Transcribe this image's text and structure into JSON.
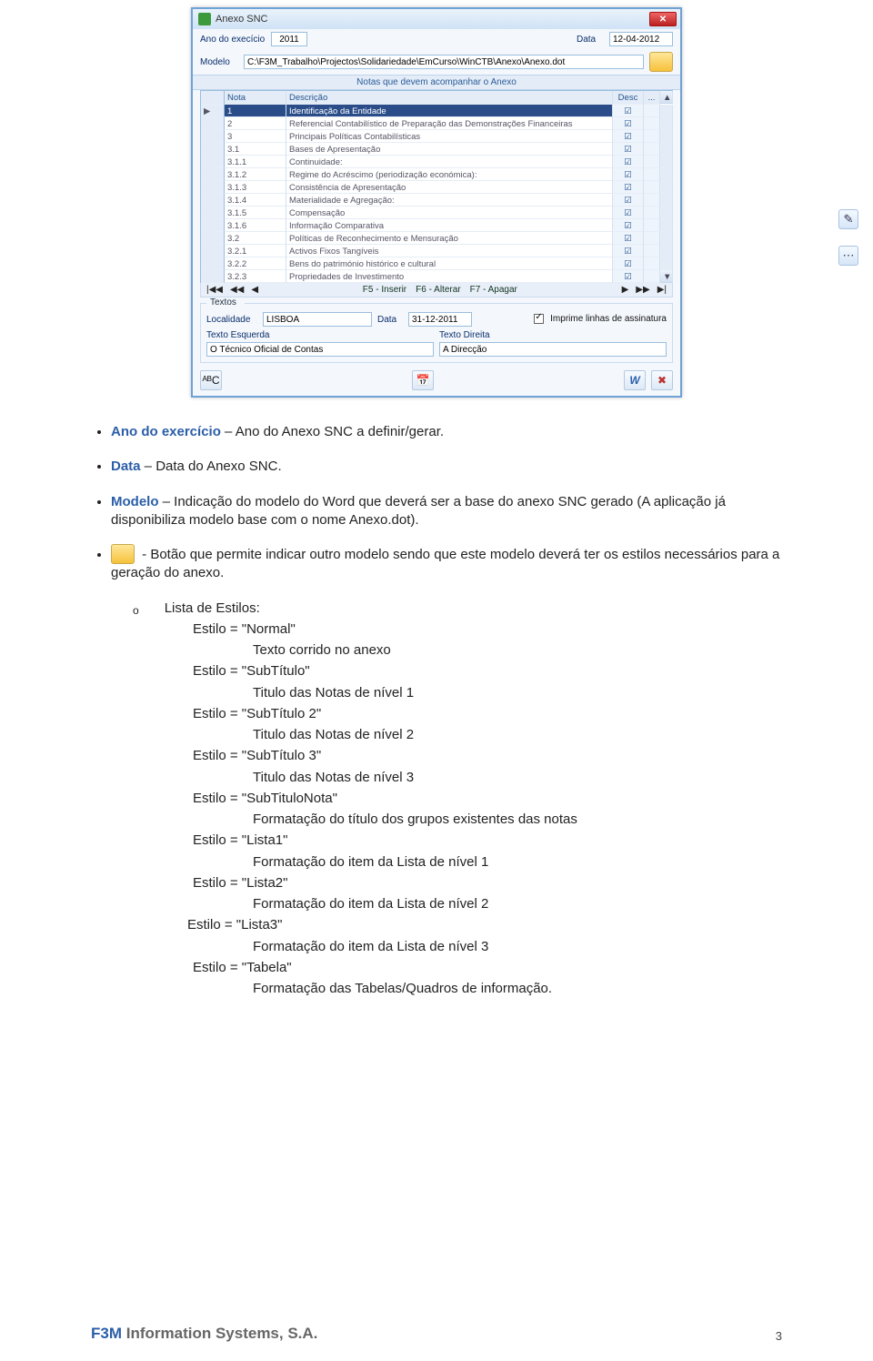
{
  "window": {
    "title": "Anexo SNC",
    "fields": {
      "ano_label": "Ano do execício",
      "ano_value": "2011",
      "data_label": "Data",
      "data_value": "12-04-2012",
      "modelo_label": "Modelo",
      "modelo_value": "C:\\F3M_Trabalho\\Projectos\\Solidariedade\\EmCurso\\WinCTB\\Anexo\\Anexo.dot"
    },
    "subheader": "Notas que devem acompanhar o Anexo",
    "grid": {
      "col_nota": "Nota",
      "col_desc": "Descrição",
      "col_desc2": "Desc",
      "col_dots": "...",
      "rows": [
        {
          "n": "1",
          "d": "Identificação da Entidade",
          "sel": true
        },
        {
          "n": "2",
          "d": "Referencial Contabilístico de Preparação das Demonstrações Financeiras"
        },
        {
          "n": "3",
          "d": "Principais Políticas Contabilísticas"
        },
        {
          "n": "3.1",
          "d": "Bases de Apresentação"
        },
        {
          "n": "3.1.1",
          "d": "Continuidade:"
        },
        {
          "n": "3.1.2",
          "d": "Regime do Acréscimo (periodização económica):"
        },
        {
          "n": "3.1.3",
          "d": "Consistência de Apresentação"
        },
        {
          "n": "3.1.4",
          "d": "Materialidade e Agregação:"
        },
        {
          "n": "3.1.5",
          "d": "Compensação"
        },
        {
          "n": "3.1.6",
          "d": "Informação Comparativa"
        },
        {
          "n": "3.2",
          "d": "Políticas de Reconhecimento e Mensuração"
        },
        {
          "n": "3.2.1",
          "d": "Activos Fixos Tangíveis"
        },
        {
          "n": "3.2.2",
          "d": "Bens do património histórico e cultural"
        },
        {
          "n": "3.2.3",
          "d": "Propriedades de Investimento"
        }
      ]
    },
    "navbar": {
      "arr_first": "|◀◀",
      "arr_prev2": "◀◀",
      "arr_prev": "◀",
      "op_ins": "F5 - Inserir",
      "op_alt": "F6 - Alterar",
      "op_del": "F7 - Apagar",
      "arr_next": "▶",
      "arr_next2": "▶▶",
      "arr_last": "▶|"
    },
    "textos": {
      "legend": "Textos",
      "loc_label": "Localidade",
      "loc_value": "LISBOA",
      "dt_label": "Data",
      "dt_value": "31-12-2011",
      "print_label": "Imprime linhas de assinatura",
      "esq_label": "Texto Esquerda",
      "esq_value": "O Técnico Oficial de Contas",
      "dir_label": "Texto Direita",
      "dir_value": "A Direcção"
    },
    "bottom": {
      "abc": "ᴬᴮC",
      "cal": "📅",
      "word": "W",
      "exit": "✖"
    }
  },
  "edge": {
    "pencil": "✎",
    "dots": "⋯"
  },
  "doc": {
    "li1_blue": "Ano do exercício",
    "li1_rest": " – Ano do Anexo SNC a definir/gerar.",
    "li2_blue": "Data",
    "li2_rest": " – Data do Anexo SNC.",
    "li3_blue": "Modelo",
    "li3_rest": " – Indicação do modelo do Word que deverá ser a base do anexo SNC gerado (A aplicação já disponibiliza modelo base com o nome Anexo.dot).",
    "li4": " - Botão que permite indicar outro modelo sendo que este modelo deverá ter os estilos necessários para a geração do anexo.",
    "styles_lead_o": "o",
    "styles_lead": "Lista de Estilos:",
    "s_normal_t": "Estilo = \"Normal\"",
    "s_normal_d": "Texto corrido no anexo",
    "s_sub_t": "Estilo = \"SubTítulo\"",
    "s_sub_d": "Titulo das Notas de nível 1",
    "s_sub2_t": "Estilo = \"SubTítulo 2\"",
    "s_sub2_d": "Titulo das Notas de nível 2",
    "s_sub3_t": "Estilo = \"SubTítulo 3\"",
    "s_sub3_d": "Titulo das Notas de nível 3",
    "s_sn_t": "Estilo = \"SubTituloNota\"",
    "s_sn_d": "Formatação do título dos grupos existentes das notas",
    "s_l1_t": "Estilo = \"Lista1\"",
    "s_l1_d": "Formatação do item da Lista de nível 1",
    "s_l2_t": "Estilo = \"Lista2\"",
    "s_l2_d": "Formatação do item da Lista de nível 2",
    "s_l3_t": "Estilo = \"Lista3\"",
    "s_l3_d": "Formatação do item da Lista de nível 3",
    "s_tab_t": "Estilo = \"Tabela\"",
    "s_tab_d": "Formatação das Tabelas/Quadros de informação."
  },
  "footer": {
    "brand_f": "F3M ",
    "brand_rest": "Information Systems, S.A.",
    "page": "3"
  }
}
